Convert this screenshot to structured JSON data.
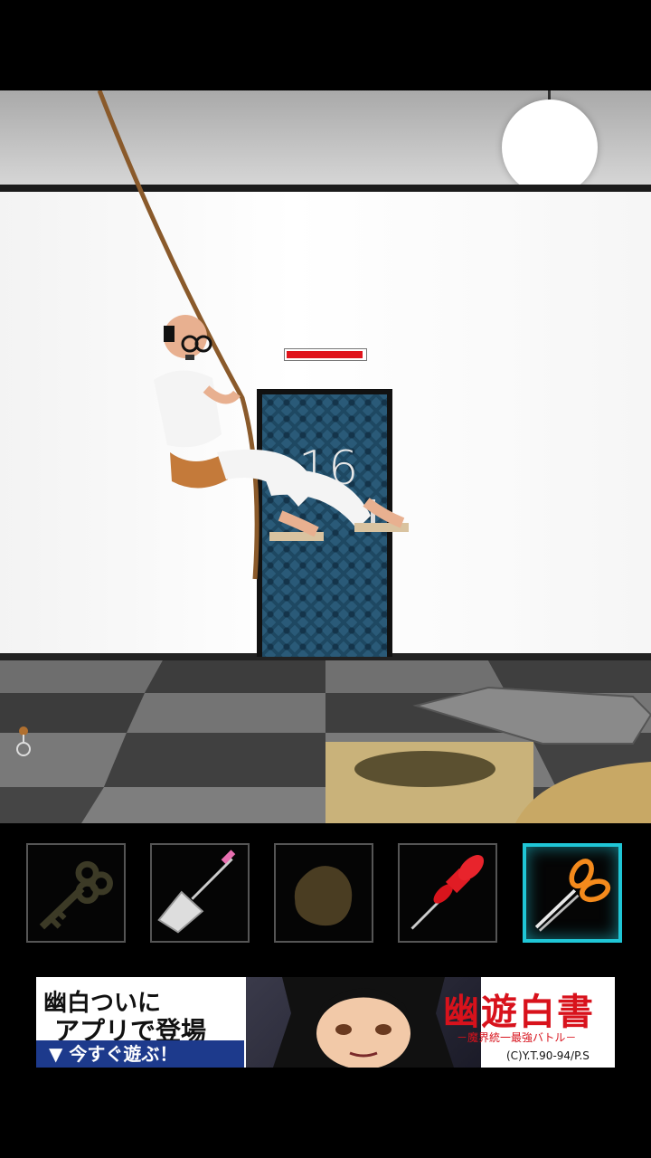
{
  "colors": {
    "selection": "#1fc6d6",
    "health_bar": "#e0141c",
    "door": "#2a5a78",
    "ad_cta": "#1d3a8c",
    "ad_logo": "#d8121c"
  },
  "scene": {
    "room_number": "16",
    "boss_health_fraction": 0.98
  },
  "inventory": {
    "slots": [
      {
        "item": "key-icon",
        "selected": false
      },
      {
        "item": "shovel-icon",
        "selected": false
      },
      {
        "item": "dirt-clod-icon",
        "selected": false
      },
      {
        "item": "pushpin-icon",
        "selected": false
      },
      {
        "item": "scissors-icon",
        "selected": true
      }
    ]
  },
  "ad": {
    "line1": "幽白ついに",
    "line2": "アプリで登場",
    "cta": "▼ 今すぐ遊ぶ！",
    "logo": "幽遊白書",
    "subtitle": "－魔界統一最強バトル－",
    "copyright": "(C)Y.T.90-94/P.S"
  }
}
